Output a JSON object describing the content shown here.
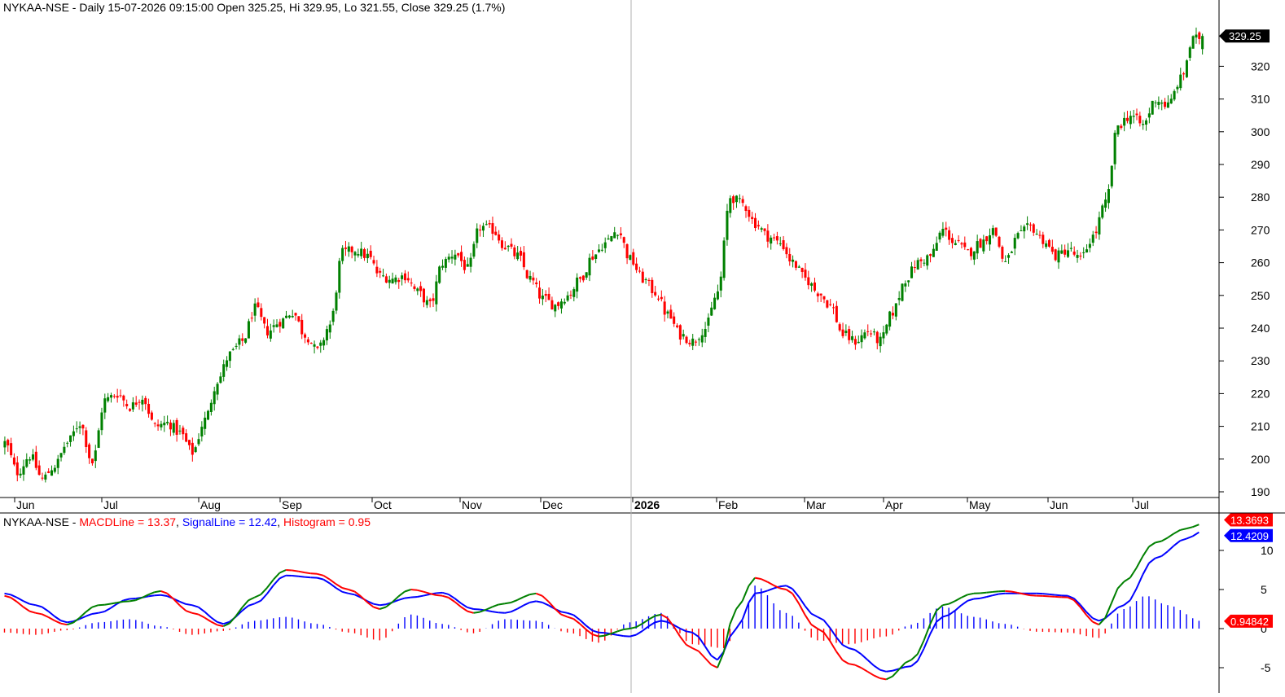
{
  "price_header": "NYKAA-NSE - Daily 15-07-2026 09:15:00 Open 325.25, Hi 329.95, Lo 321.55, Close 329.25 (1.7%)",
  "macd_header": {
    "prefix": "NYKAA-NSE - ",
    "macd": "MACDLine = 13.37",
    "sep1": ", ",
    "signal": "SignalLine = 12.42",
    "sep2": ", ",
    "hist": "Histogram = 0.95"
  },
  "colors": {
    "up": "#008000",
    "down": "#ff0000",
    "macd_rising": "#008000",
    "signal": "#0000ff",
    "hist_pos": "#0000ff",
    "hist_neg": "#ff0000",
    "tag_dark": "#000000"
  },
  "chart_data": [
    {
      "type": "candlestick",
      "ylim": [
        186,
        336
      ],
      "y_ticks": [
        190,
        200,
        210,
        220,
        230,
        240,
        250,
        260,
        270,
        280,
        290,
        300,
        310,
        320
      ],
      "x_labels": [
        "Jun",
        "Jul",
        "Aug",
        "Sep",
        "Oct",
        "Nov",
        "Dec",
        "2026",
        "Feb",
        "Mar",
        "Apr",
        "May",
        "Jun",
        "Jul"
      ],
      "last_close_label": "329.25",
      "close_anchors": [
        [
          0,
          205
        ],
        [
          4,
          196
        ],
        [
          8,
          201
        ],
        [
          12,
          194
        ],
        [
          16,
          198
        ],
        [
          20,
          205
        ],
        [
          24,
          211
        ],
        [
          28,
          199
        ],
        [
          32,
          218
        ],
        [
          36,
          220
        ],
        [
          40,
          216
        ],
        [
          44,
          219
        ],
        [
          48,
          210
        ],
        [
          52,
          211
        ],
        [
          56,
          208
        ],
        [
          60,
          202
        ],
        [
          64,
          212
        ],
        [
          68,
          224
        ],
        [
          72,
          232
        ],
        [
          76,
          236
        ],
        [
          80,
          246
        ],
        [
          84,
          239
        ],
        [
          88,
          242
        ],
        [
          92,
          245
        ],
        [
          96,
          238
        ],
        [
          100,
          233
        ],
        [
          104,
          241
        ],
        [
          108,
          263
        ],
        [
          112,
          264
        ],
        [
          116,
          262
        ],
        [
          120,
          256
        ],
        [
          124,
          255
        ],
        [
          128,
          256
        ],
        [
          132,
          251
        ],
        [
          136,
          247
        ],
        [
          140,
          260
        ],
        [
          144,
          263
        ],
        [
          148,
          258
        ],
        [
          152,
          271
        ],
        [
          156,
          270
        ],
        [
          160,
          265
        ],
        [
          164,
          262
        ],
        [
          168,
          255
        ],
        [
          172,
          249
        ],
        [
          176,
          247
        ],
        [
          180,
          250
        ],
        [
          184,
          255
        ],
        [
          188,
          262
        ],
        [
          192,
          266
        ],
        [
          196,
          270
        ],
        [
          200,
          261
        ],
        [
          204,
          255
        ],
        [
          208,
          251
        ],
        [
          212,
          244
        ],
        [
          216,
          238
        ],
        [
          220,
          236
        ],
        [
          224,
          240
        ],
        [
          228,
          251
        ],
        [
          232,
          280
        ],
        [
          236,
          278
        ],
        [
          240,
          272
        ],
        [
          244,
          268
        ],
        [
          248,
          266
        ],
        [
          252,
          260
        ],
        [
          256,
          255
        ],
        [
          260,
          251
        ],
        [
          264,
          247
        ],
        [
          268,
          238
        ],
        [
          272,
          236
        ],
        [
          276,
          239
        ],
        [
          280,
          236
        ],
        [
          284,
          245
        ],
        [
          288,
          255
        ],
        [
          292,
          260
        ],
        [
          296,
          262
        ],
        [
          300,
          270
        ],
        [
          304,
          266
        ],
        [
          308,
          263
        ],
        [
          312,
          266
        ],
        [
          316,
          270
        ],
        [
          320,
          260
        ],
        [
          324,
          268
        ],
        [
          328,
          271
        ],
        [
          332,
          267
        ],
        [
          336,
          262
        ],
        [
          340,
          264
        ],
        [
          344,
          261
        ],
        [
          348,
          268
        ],
        [
          352,
          278
        ],
        [
          356,
          302
        ],
        [
          360,
          305
        ],
        [
          364,
          302
        ],
        [
          368,
          310
        ],
        [
          372,
          308
        ],
        [
          376,
          316
        ],
        [
          380,
          328
        ],
        [
          383,
          329.25
        ]
      ]
    },
    {
      "type": "macd",
      "ylim": [
        -7.5,
        15.5
      ],
      "y_ticks": [
        -5,
        0,
        5,
        10
      ],
      "series": [
        {
          "name": "MACDLine",
          "last_label": "13.3693",
          "anchors": [
            [
              0,
              4.2
            ],
            [
              10,
              2
            ],
            [
              20,
              0.5
            ],
            [
              30,
              3
            ],
            [
              40,
              3.5
            ],
            [
              50,
              4.8
            ],
            [
              60,
              2
            ],
            [
              70,
              0.3
            ],
            [
              80,
              4
            ],
            [
              90,
              7.5
            ],
            [
              100,
              7
            ],
            [
              110,
              5
            ],
            [
              120,
              2.5
            ],
            [
              130,
              5
            ],
            [
              140,
              4.2
            ],
            [
              150,
              2
            ],
            [
              160,
              3.2
            ],
            [
              170,
              4.5
            ],
            [
              180,
              1.5
            ],
            [
              190,
              -1
            ],
            [
              200,
              0
            ],
            [
              210,
              1.8
            ],
            [
              220,
              -2.5
            ],
            [
              228,
              -5
            ],
            [
              234,
              2.5
            ],
            [
              240,
              6.5
            ],
            [
              250,
              5
            ],
            [
              260,
              0
            ],
            [
              270,
              -4.5
            ],
            [
              282,
              -6.5
            ],
            [
              290,
              -4
            ],
            [
              300,
              3
            ],
            [
              310,
              4.5
            ],
            [
              320,
              4.8
            ],
            [
              330,
              4.2
            ],
            [
              340,
              4
            ],
            [
              350,
              0.5
            ],
            [
              358,
              6
            ],
            [
              368,
              11
            ],
            [
              378,
              12.8
            ],
            [
              383,
              13.37
            ]
          ]
        },
        {
          "name": "SignalLine",
          "last_label": "12.4209",
          "anchors": [
            [
              0,
              4.5
            ],
            [
              10,
              3
            ],
            [
              20,
              0.8
            ],
            [
              30,
              2
            ],
            [
              40,
              3.8
            ],
            [
              50,
              4.3
            ],
            [
              60,
              3
            ],
            [
              70,
              0.6
            ],
            [
              80,
              3.2
            ],
            [
              90,
              6.8
            ],
            [
              100,
              6.5
            ],
            [
              110,
              4.5
            ],
            [
              120,
              3
            ],
            [
              130,
              4
            ],
            [
              140,
              4.6
            ],
            [
              150,
              2.5
            ],
            [
              160,
              2
            ],
            [
              170,
              3.5
            ],
            [
              180,
              2
            ],
            [
              190,
              -0.5
            ],
            [
              200,
              -1
            ],
            [
              210,
              1
            ],
            [
              220,
              -0.5
            ],
            [
              228,
              -4
            ],
            [
              234,
              0
            ],
            [
              240,
              4.5
            ],
            [
              250,
              5.5
            ],
            [
              260,
              1.5
            ],
            [
              270,
              -2.5
            ],
            [
              282,
              -5.5
            ],
            [
              290,
              -4.8
            ],
            [
              300,
              1.5
            ],
            [
              310,
              3.8
            ],
            [
              320,
              4.5
            ],
            [
              330,
              4.5
            ],
            [
              340,
              4.2
            ],
            [
              350,
              1
            ],
            [
              358,
              3
            ],
            [
              368,
              9
            ],
            [
              378,
              11.5
            ],
            [
              383,
              12.42
            ]
          ]
        },
        {
          "name": "Histogram",
          "last_label": "0.94842",
          "anchors": [
            [
              0,
              -0.5
            ],
            [
              10,
              -0.8
            ],
            [
              20,
              -0.2
            ],
            [
              30,
              0.8
            ],
            [
              40,
              1.2
            ],
            [
              50,
              0.3
            ],
            [
              60,
              -0.8
            ],
            [
              70,
              -0.3
            ],
            [
              80,
              1
            ],
            [
              90,
              1.5
            ],
            [
              100,
              0.6
            ],
            [
              110,
              -0.5
            ],
            [
              120,
              -1.5
            ],
            [
              130,
              1.8
            ],
            [
              140,
              0.6
            ],
            [
              150,
              -0.6
            ],
            [
              160,
              1.2
            ],
            [
              170,
              1
            ],
            [
              180,
              -0.5
            ],
            [
              190,
              -1.8
            ],
            [
              200,
              0.8
            ],
            [
              210,
              2
            ],
            [
              220,
              -2
            ],
            [
              230,
              -2.5
            ],
            [
              236,
              1
            ],
            [
              240,
              5.5
            ],
            [
              250,
              2
            ],
            [
              260,
              -1.5
            ],
            [
              270,
              -2
            ],
            [
              282,
              -1
            ],
            [
              290,
              0.5
            ],
            [
              300,
              2.8
            ],
            [
              310,
              1.5
            ],
            [
              320,
              0.6
            ],
            [
              330,
              -0.4
            ],
            [
              340,
              -0.5
            ],
            [
              350,
              -1.2
            ],
            [
              358,
              2.5
            ],
            [
              365,
              4.2
            ],
            [
              372,
              3
            ],
            [
              383,
              0.95
            ]
          ]
        }
      ]
    }
  ]
}
